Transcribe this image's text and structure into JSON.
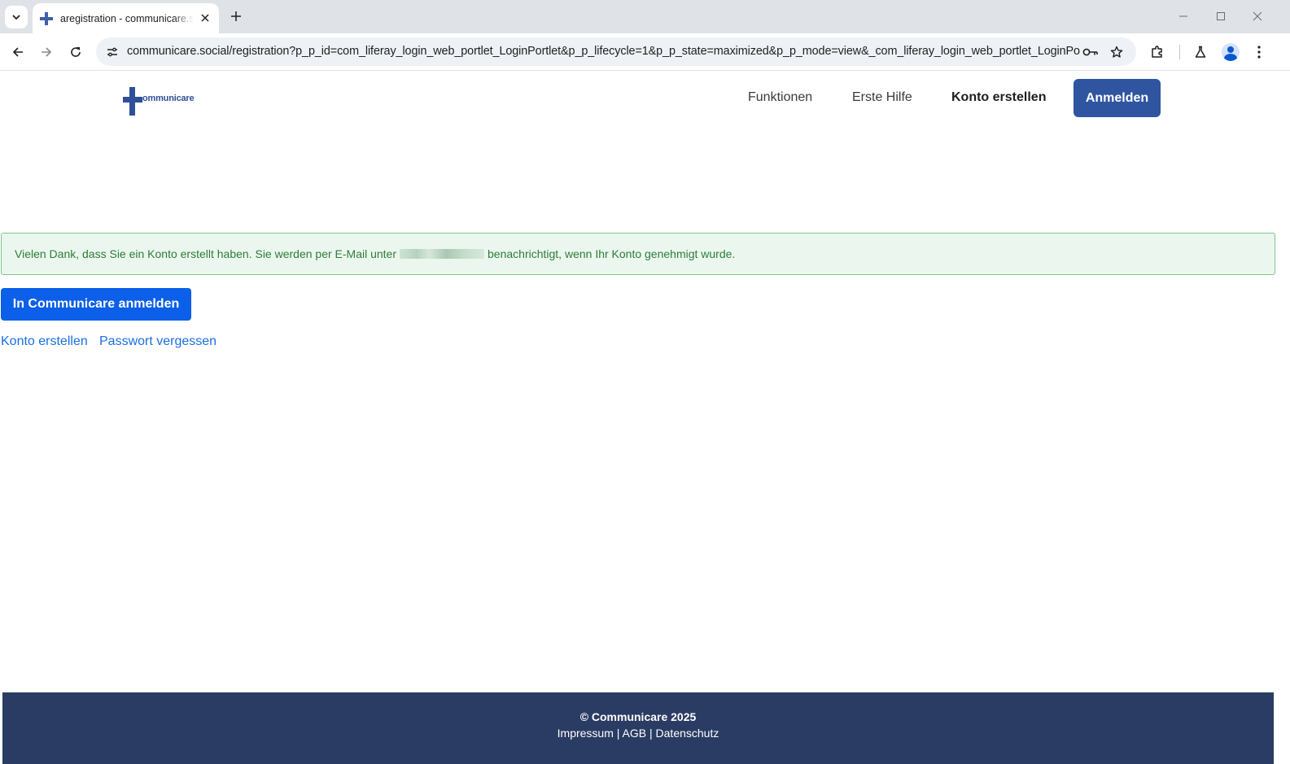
{
  "browser": {
    "tab_title": "aregistration - communicare.social",
    "url": "communicare.social/registration?p_p_id=com_liferay_login_web_portlet_LoginPortlet&p_p_lifecycle=1&p_p_state=maximized&p_p_mode=view&_com_liferay_login_web_portlet_LoginPortlet_..."
  },
  "header": {
    "logo_text": "ommunicare",
    "nav": {
      "funktionen": "Funktionen",
      "erste_hilfe": "Erste Hilfe",
      "konto_erstellen": "Konto erstellen",
      "anmelden": "Anmelden"
    }
  },
  "alert": {
    "text_before": "Vielen Dank, dass Sie ein Konto erstellt haben. Sie werden per E-Mail unter",
    "text_after": "benachrichtigt, wenn Ihr Konto genehmigt wurde."
  },
  "main": {
    "primary_button": "In Communicare anmelden",
    "link_create": "Konto erstellen",
    "link_forgot": "Passwort vergessen"
  },
  "footer": {
    "copyright": "© Communicare 2025",
    "impressum": "Impressum",
    "agb": "AGB",
    "datenschutz": "Datenschutz",
    "separator": "|"
  },
  "colors": {
    "brand": "#2f55a0",
    "primary": "#0b5fe8",
    "footer": "#2a3c63",
    "alert_bg": "#ebf7ee",
    "alert_text": "#2e7d3a"
  }
}
